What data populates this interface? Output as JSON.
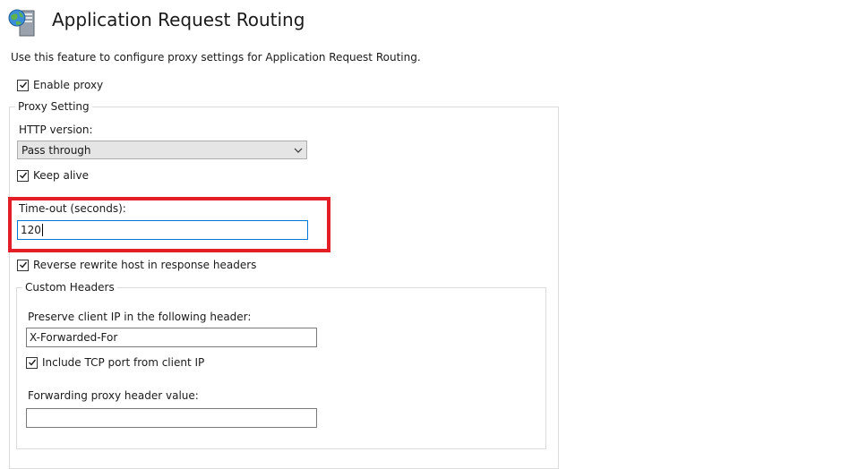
{
  "header": {
    "icon": "server-globe-icon",
    "title": "Application Request Routing"
  },
  "description": "Use this feature to configure proxy settings for Application Request Routing.",
  "enable_proxy": {
    "label": "Enable proxy",
    "checked": true
  },
  "proxy_setting": {
    "legend": "Proxy Setting",
    "http_version": {
      "label": "HTTP version:",
      "value": "Pass through"
    },
    "keep_alive": {
      "label": "Keep alive",
      "checked": true
    },
    "timeout": {
      "label": "Time-out (seconds):",
      "value": "120"
    },
    "reverse_rewrite": {
      "label": "Reverse rewrite host in response headers",
      "checked": true
    },
    "custom_headers": {
      "legend": "Custom Headers",
      "preserve_ip": {
        "label": "Preserve client IP in the following header:",
        "value": "X-Forwarded-For"
      },
      "include_tcp_port": {
        "label": "Include TCP port from client IP",
        "checked": true
      },
      "forwarding_header": {
        "label": "Forwarding proxy header value:",
        "value": ""
      }
    }
  },
  "colors": {
    "highlight": "#e41e26",
    "focus_border": "#0078d7"
  }
}
